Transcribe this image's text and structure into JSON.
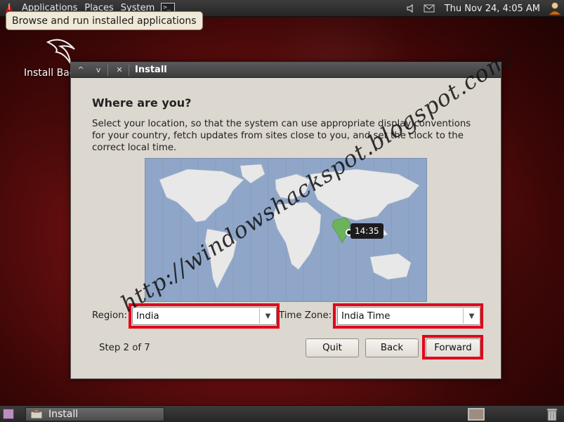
{
  "top_panel": {
    "menus": [
      "Applications",
      "Places",
      "System"
    ],
    "terminal_glyph": ">_",
    "clock": "Thu Nov 24,  4:05 AM"
  },
  "tooltip": "Browse and run installed applications",
  "desktop": {
    "icon_label": "Install Bac"
  },
  "window": {
    "title": "Install",
    "heading": "Where are you?",
    "description": "Select your location, so that the system can use appropriate display conventions for your country, fetch updates from sites close to you, and set the clock to the correct local time.",
    "map": {
      "selected_time": "14:35"
    },
    "watermark": "http://windowshackspot.blogspot.com/",
    "region_label": "Region:",
    "region_value": "India",
    "timezone_label": "Time Zone:",
    "timezone_value": "India Time",
    "step": "Step 2 of 7",
    "buttons": {
      "quit": "Quit",
      "back": "Back",
      "forward": "Forward"
    }
  },
  "taskbar": {
    "task_label": "Install"
  },
  "colors": {
    "highlight": "#e2061c",
    "selected_country": "#6db35b",
    "ocean": "#8fa6c8",
    "land": "#e8e8e8"
  }
}
